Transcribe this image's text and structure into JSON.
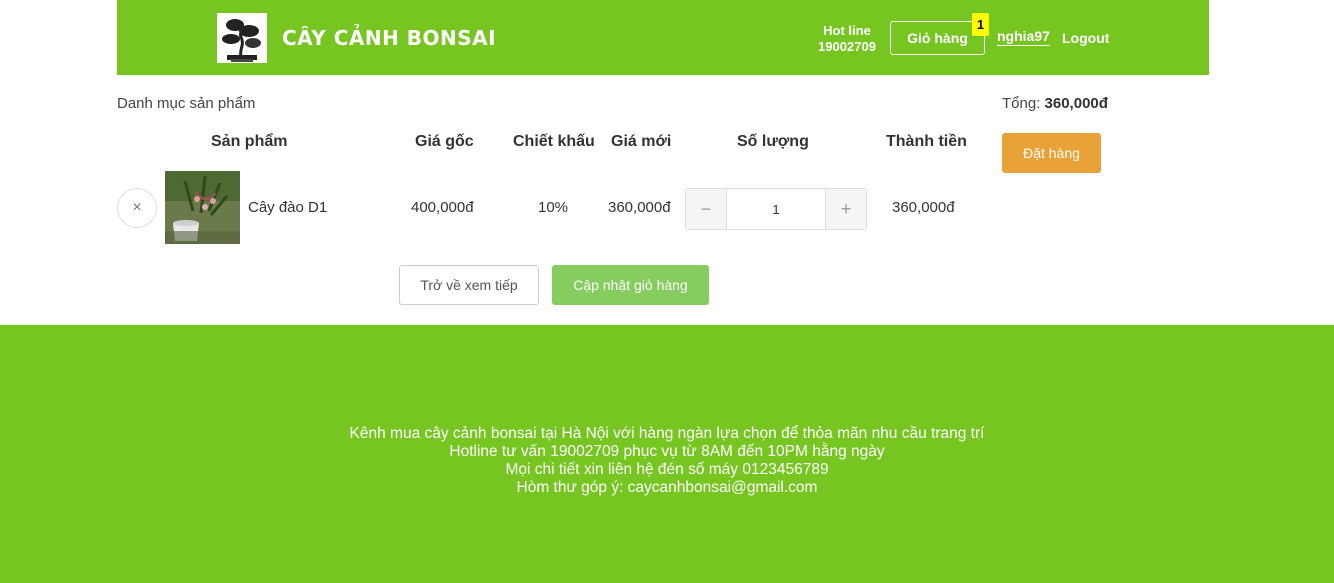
{
  "header": {
    "brand": "CÂY CẢNH BONSAI",
    "hotline_label": "Hot line",
    "hotline_number": "19002709",
    "cart_label": "Giỏ hàng",
    "cart_count": "1",
    "username": "nghia97",
    "logout": "Logout",
    "logo_icon": "bonsai-tree-icon"
  },
  "cart": {
    "category_title": "Danh mục sản phẩm",
    "total_label": "Tổng:",
    "total_value": "360,000đ",
    "columns": {
      "product": "Sản phẩm",
      "original_price": "Giá gốc",
      "discount": "Chiết khấu",
      "new_price": "Giá mới",
      "quantity": "Số lượng",
      "subtotal": "Thành tiền"
    },
    "items": [
      {
        "name": "Cây đào D1",
        "original_price": "400,000đ",
        "discount": "10%",
        "new_price": "360,000đ",
        "quantity": "1",
        "subtotal": "360,000đ"
      }
    ],
    "order_button": "Đặt hàng",
    "back_button": "Trở về xem tiếp",
    "update_button": "Cập nhật giỏ hàng",
    "remove_icon": "×",
    "minus_icon": "−",
    "plus_icon": "+"
  },
  "footer": {
    "lines": [
      "Kênh mua cây cảnh bonsai tại Hà Nội với hàng ngàn lựa chọn để thỏa mãn nhu cầu trang trí",
      "Hotline tư vấn 19002709 phục vụ từ 8AM đến 10PM hằng ngày",
      "Mọi chi tiết xin liên hệ đén số máy 0123456789",
      "Hòm thư góp ý: caycanhbonsai@gmail.com"
    ]
  },
  "colors": {
    "brand_green": "#76c521",
    "order_orange": "#e8a237",
    "update_green": "#86cc5f",
    "badge_yellow": "#ffff00"
  }
}
